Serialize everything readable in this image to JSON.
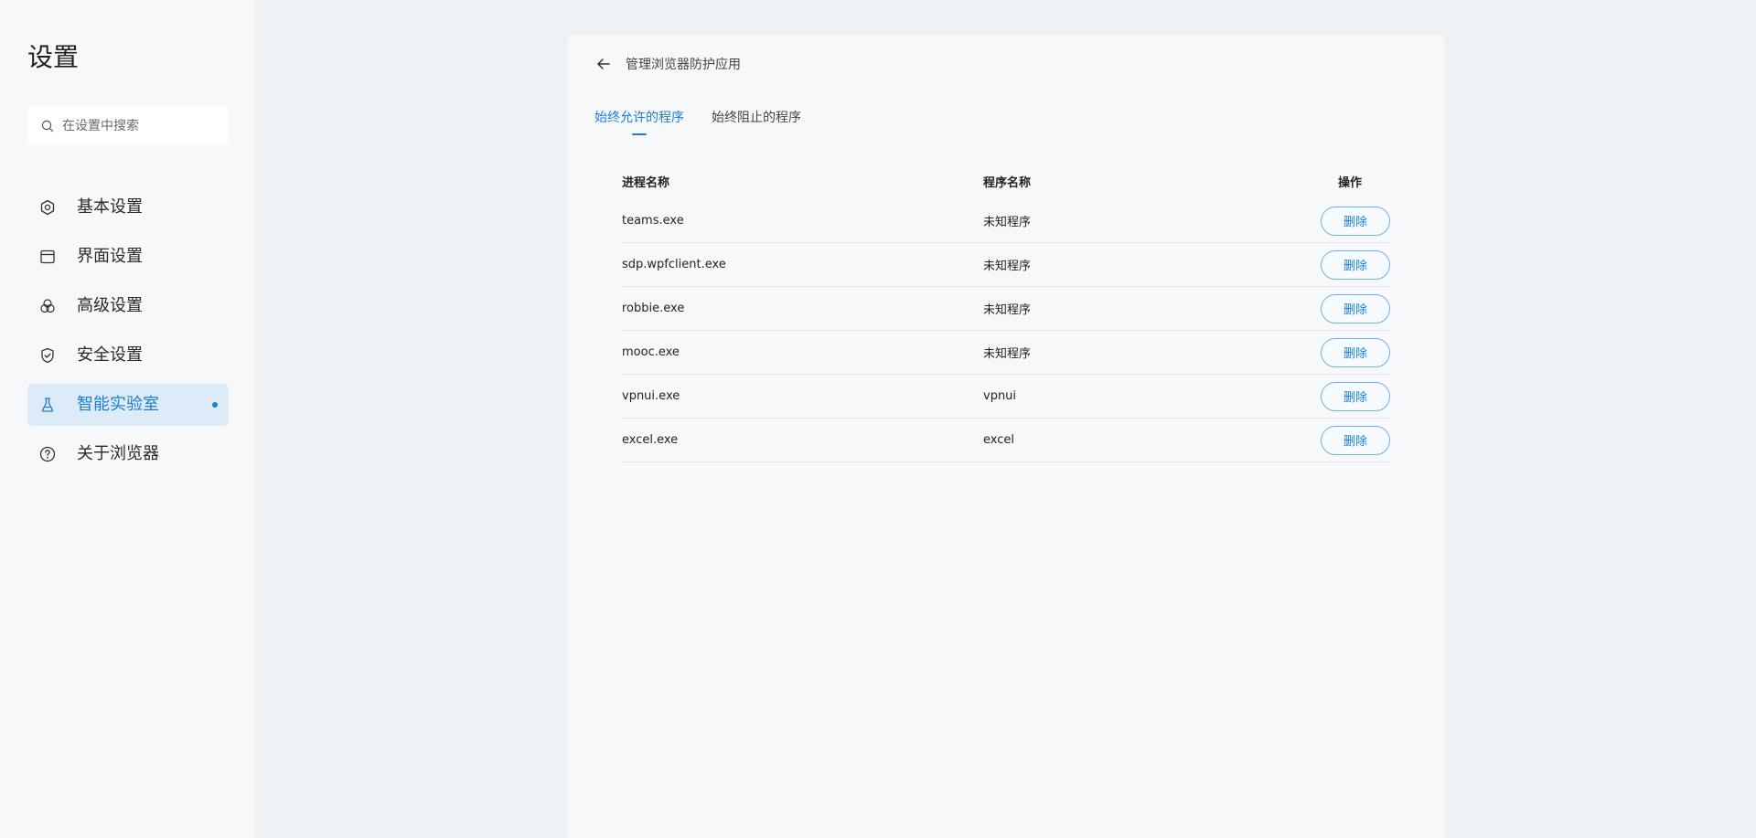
{
  "sidebar": {
    "title": "设置",
    "search": {
      "placeholder": "在设置中搜索",
      "value": ""
    },
    "items": [
      {
        "label": "基本设置",
        "icon": "hexagon-settings-icon"
      },
      {
        "label": "界面设置",
        "icon": "window-layout-icon"
      },
      {
        "label": "高级设置",
        "icon": "circles-advanced-icon"
      },
      {
        "label": "安全设置",
        "icon": "shield-check-icon"
      },
      {
        "label": "智能实验室",
        "icon": "flask-icon",
        "active": true
      },
      {
        "label": "关于浏览器",
        "icon": "question-circle-icon"
      }
    ]
  },
  "panel": {
    "title": "管理浏览器防护应用",
    "tabs": [
      {
        "label": "始终允许的程序",
        "active": true
      },
      {
        "label": "始终阻止的程序",
        "active": false
      }
    ],
    "table": {
      "headers": {
        "process": "进程名称",
        "program": "程序名称",
        "action": "操作"
      },
      "delete_label": "删除",
      "rows": [
        {
          "process": "teams.exe",
          "program": "未知程序"
        },
        {
          "process": "sdp.wpfclient.exe",
          "program": "未知程序"
        },
        {
          "process": "robbie.exe",
          "program": "未知程序"
        },
        {
          "process": "mooc.exe",
          "program": "未知程序"
        },
        {
          "process": "vpnui.exe",
          "program": "vpnui"
        },
        {
          "process": "excel.exe",
          "program": "excel"
        }
      ]
    }
  },
  "colors": {
    "accent": "#1a7fd1",
    "active_bg": "#dcebf7",
    "page_bg": "#eef1f4"
  }
}
